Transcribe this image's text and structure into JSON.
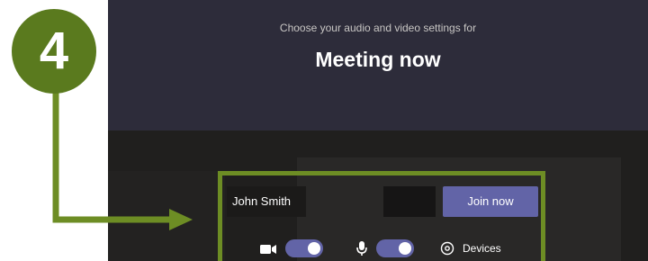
{
  "meeting": {
    "subtitle": "Choose your audio and video settings for",
    "title": "Meeting now"
  },
  "prejoin": {
    "name_value": "John Smith",
    "join_label": "Join now",
    "devices_label": "Devices",
    "video_on": true,
    "mic_on": true
  },
  "annotation": {
    "step_number": "4"
  },
  "colors": {
    "accent": "#6264a7",
    "annotation_green": "#6d8d24",
    "badge_green": "#5a7a1e",
    "header_bg": "#2d2c3a",
    "body_bg": "#201f1e"
  },
  "icons": {
    "video": "video-camera-icon",
    "mic": "microphone-icon",
    "devices": "gear-icon"
  }
}
